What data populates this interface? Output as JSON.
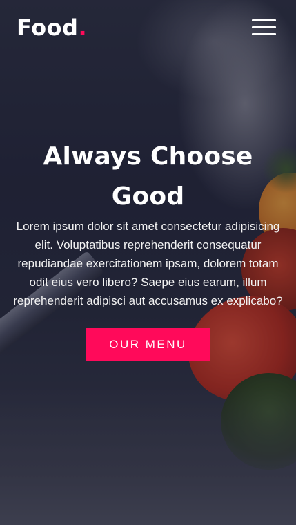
{
  "header": {
    "logo_text": "Food",
    "logo_dot": ".",
    "menu_icon": "hamburger-menu-icon"
  },
  "hero": {
    "headline": "Always Choose Good",
    "description": "Lorem ipsum dolor sit amet consectetur adipisicing elit. Voluptatibus reprehenderit consequatur repudiandae exercitationem ipsam, dolorem totam odit eius vero libero? Saepe eius earum, illum reprehenderit adipisci aut accusamus ex explicabo?",
    "cta_label": "OUR MENU"
  },
  "colors": {
    "accent": "#ff0a5a",
    "text": "#ffffff"
  }
}
